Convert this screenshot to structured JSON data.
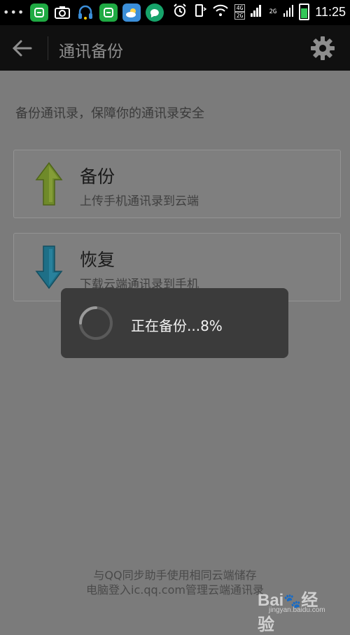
{
  "status_bar": {
    "time": "11:25",
    "network_tag_top": "4G",
    "network_tag_bottom": "2G",
    "network_tag_2": "2G"
  },
  "app_bar": {
    "title": "通讯备份"
  },
  "hint": "备份通讯录，保障你的通讯录安全",
  "cards": [
    {
      "title": "备份",
      "subtitle": "上传手机通讯录到云端",
      "color": "#8aa13b"
    },
    {
      "title": "恢复",
      "subtitle": "下载云端通讯录到手机",
      "color": "#1e6f87"
    }
  ],
  "dialog": {
    "text": "正在备份...8%",
    "progress": 0.08
  },
  "footer": {
    "line1": "与QQ同步助手使用相同云端储存",
    "line2": "电脑登入ic.qq.com管理云端通讯录"
  },
  "watermark": {
    "brand": "Bai 经验",
    "url": "jingyan.baidu.com"
  },
  "colors": {
    "overlay": "#7b7b7b",
    "app_bar": "#101010",
    "dialog": "#3b3b3b"
  }
}
